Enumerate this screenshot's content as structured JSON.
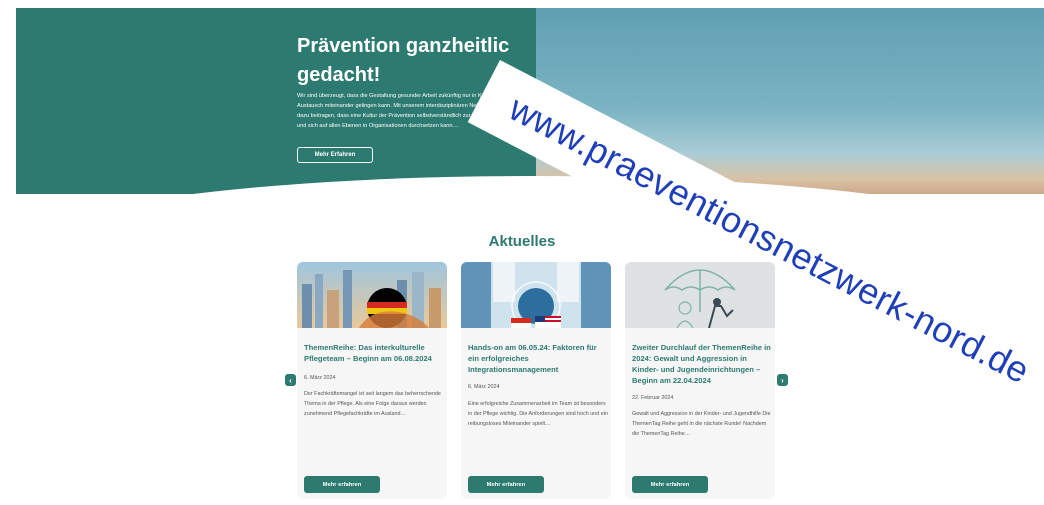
{
  "hero": {
    "title_line1": "Prävention ganzheitlic",
    "title_line2": "gedacht!",
    "text": "Wir sind überzeugt, dass die Gestaltung gesunder Arbeit zukünftig nur in Kooperation und im Austausch miteinander gelingen kann. Mit unserem interdisziplinären Netzwerk möchten wir dazu beitragen, dass eine Kultur der Prävention selbstverständlich zur gelebten Praxis wird und sich auf allen Ebenen in Organisationen durchsetzen kann.…",
    "button_label": "Mehr Erfahren",
    "image_icon": "balanced-stones-illustration"
  },
  "watermark": {
    "url": "www.praeventionsnetzwerk-nord.de",
    "color": "#1f3fb8"
  },
  "news": {
    "heading": "Aktuelles",
    "prev_icon": "chevron-left-icon",
    "next_icon": "chevron-right-icon",
    "cards": [
      {
        "title": "ThemenReihe: Das interkulturelle Pflegeteam – Beginn am 06.08.2024",
        "date": "6. März 2024",
        "description": "Der Fachkräftemangel ist seit langem das beherrschende Thema in der Pflege. Als eine Folge daraus werden zunehmend Pflegefachkräfte im Ausland…",
        "button_label": "Mehr erfahren"
      },
      {
        "title": "Hands-on am 06.05.24: Faktoren für ein erfolgreiches Integrationsmanagement",
        "date": "6. März 2024",
        "description": "Eine erfolgreiche Zusammenarbeit im Team ist besonders in der Pflege wichtig. Die Anforderungen sind hoch und ein reibungsloses Miteinander spielt…",
        "button_label": "Mehr erfahren"
      },
      {
        "title": "Zweiter Durchlauf der ThemenReihe in 2024: Gewalt und Aggression in Kinder- und Jugendeinrichtungen – Beginn am 22.04.2024",
        "date": "22. Februar 2024",
        "description": "Gewalt und Aggression in der Kinder- und Jugendhilfe  Die ThemenTag Reihe geht in die nächste Runde!  Nachdem die ThemenTag Reihe…",
        "button_label": "Mehr erfahren"
      }
    ]
  },
  "colors": {
    "brand": "#2d7a70",
    "card_bg": "#f6f6f6"
  }
}
